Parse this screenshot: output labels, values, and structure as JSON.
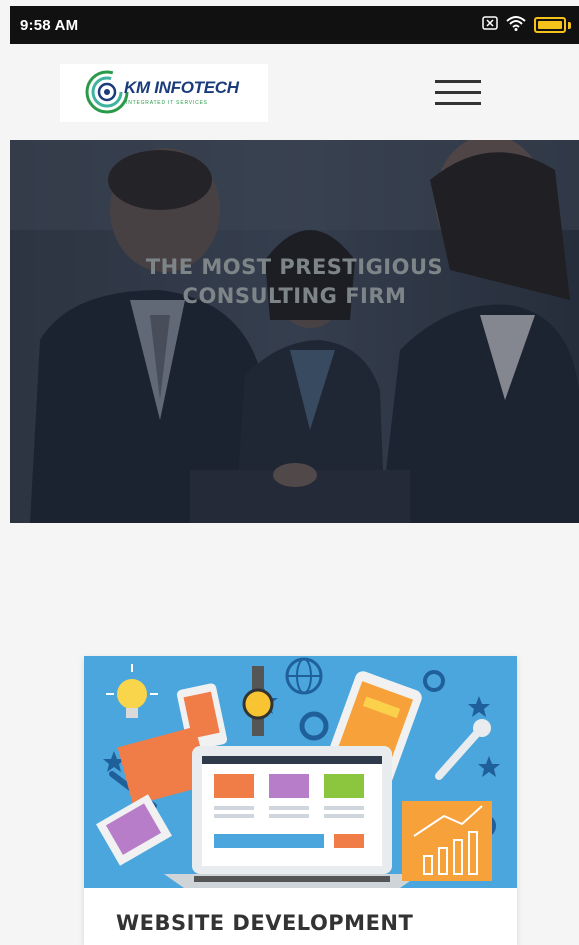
{
  "status_bar": {
    "time": "9:58 AM",
    "icons": [
      "sim-card-icon",
      "wifi-icon",
      "battery-icon"
    ],
    "battery_color": "#f4c21b"
  },
  "header": {
    "logo": {
      "name": "KM INFOTECH",
      "tagline": "INTEGRATED IT SERVICES",
      "icon": "logo-icon"
    },
    "menu_icon": "hamburger-menu-icon"
  },
  "hero": {
    "title_line1": "THE MOST PRESTIGIOUS",
    "title_line2": "CONSULTING FIRM",
    "image": "business-people-meeting-photo"
  },
  "services": [
    {
      "title": "WEBSITE DEVELOPMENT",
      "image": "website-development-illustration"
    }
  ],
  "colors": {
    "page_bg": "#f5f5f5",
    "logo_blue": "#1a3c7a",
    "logo_green": "#2a9a4a",
    "illustration_bg": "#4aa6dc"
  }
}
